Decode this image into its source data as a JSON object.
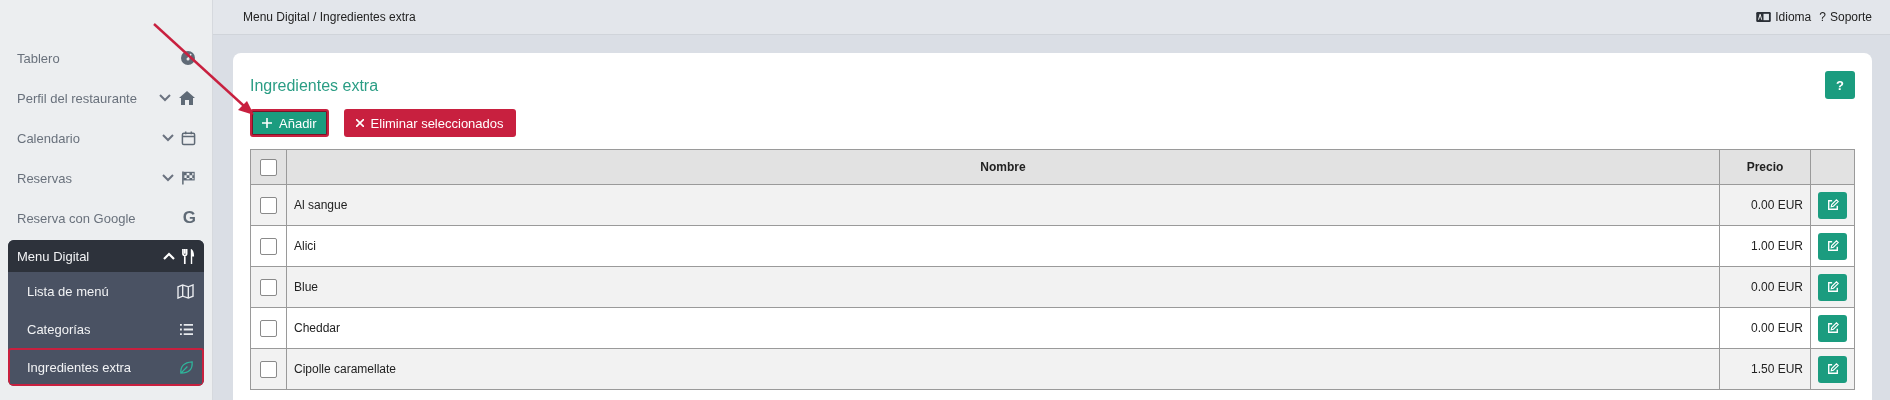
{
  "sidebar": {
    "items": [
      {
        "label": "Tablero"
      },
      {
        "label": "Perfil del restaurante",
        "expanded": false
      },
      {
        "label": "Calendario",
        "expanded": false
      },
      {
        "label": "Reservas",
        "expanded": false
      },
      {
        "label": "Reserva con Google",
        "icon": "G"
      },
      {
        "label": "Menu Digital",
        "expanded": true,
        "children": [
          {
            "label": "Lista de menú",
            "selected": false,
            "annotated": false
          },
          {
            "label": "Categorías",
            "selected": false,
            "annotated": false
          },
          {
            "label": "Ingredientes extra",
            "selected": true,
            "annotated": true
          }
        ]
      }
    ]
  },
  "topbar": {
    "breadcrumb": "Menu Digital / Ingredientes extra",
    "links": [
      {
        "kind": "language",
        "label": "Idioma"
      },
      {
        "kind": "support",
        "icon": "?",
        "label": "Soporte"
      }
    ]
  },
  "card": {
    "title": "Ingredientes extra",
    "help": "?",
    "actions": [
      {
        "kind": "add",
        "label": "Añadir",
        "annotated": true
      },
      {
        "kind": "delete",
        "label": "Eliminar seleccionados",
        "annotated": false
      }
    ],
    "table": {
      "header_checked": false,
      "columns": [
        "Nombre",
        "Precio"
      ],
      "rows": [
        {
          "name": "Al sangue",
          "price": "0.00 EUR",
          "checked": false
        },
        {
          "name": "Alici",
          "price": "1.00 EUR",
          "checked": false
        },
        {
          "name": "Blue",
          "price": "0.00 EUR",
          "checked": false
        },
        {
          "name": "Cheddar",
          "price": "0.00 EUR",
          "checked": false
        },
        {
          "name": "Cipolle caramellate",
          "price": "1.50 EUR",
          "checked": false
        }
      ]
    }
  },
  "annotation": {
    "arrow": true
  }
}
